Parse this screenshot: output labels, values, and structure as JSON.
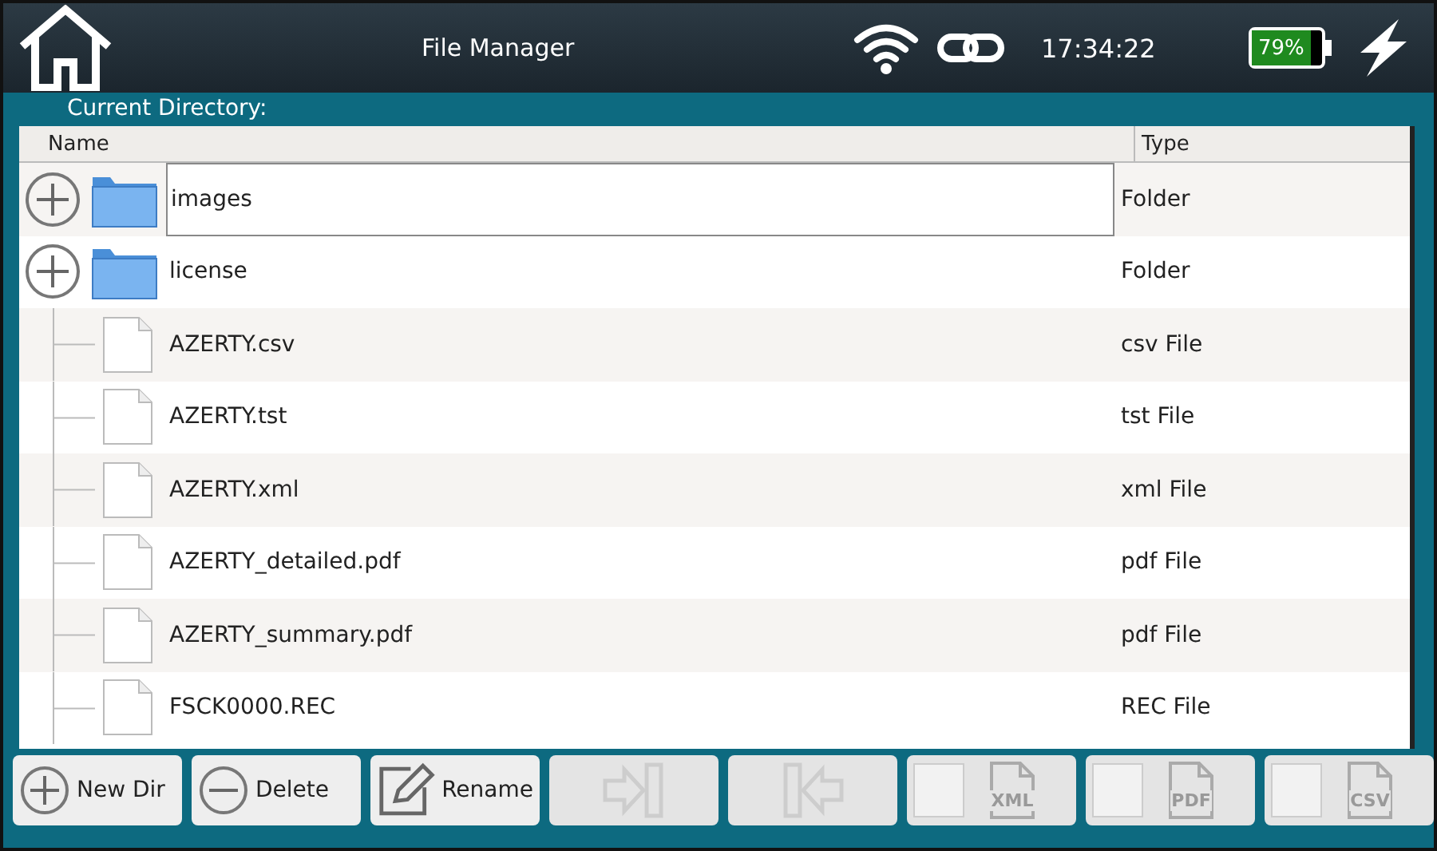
{
  "header": {
    "title": "File Manager",
    "time": "17:34:22",
    "battery": "79%"
  },
  "directory": {
    "label": "Current Directory:"
  },
  "table": {
    "columns": [
      "Name",
      "Type"
    ],
    "rows": [
      {
        "kind": "folder",
        "name": "images",
        "type": "Folder",
        "selected": true
      },
      {
        "kind": "folder",
        "name": "license",
        "type": "Folder",
        "selected": false
      },
      {
        "kind": "file",
        "name": "AZERTY.csv",
        "type": "csv File",
        "selected": false
      },
      {
        "kind": "file",
        "name": "AZERTY.tst",
        "type": "tst File",
        "selected": false
      },
      {
        "kind": "file",
        "name": "AZERTY.xml",
        "type": "xml File",
        "selected": false
      },
      {
        "kind": "file",
        "name": "AZERTY_detailed.pdf",
        "type": "pdf File",
        "selected": false
      },
      {
        "kind": "file",
        "name": "AZERTY_summary.pdf",
        "type": "pdf File",
        "selected": false
      },
      {
        "kind": "file",
        "name": "FSCK0000.REC",
        "type": "REC File",
        "selected": false
      }
    ]
  },
  "buttons": [
    {
      "kind": "plus",
      "label": "New Dir",
      "disabled": false
    },
    {
      "kind": "minus",
      "label": "Delete",
      "disabled": false
    },
    {
      "kind": "pencil",
      "label": "Rename",
      "disabled": false
    },
    {
      "kind": "import",
      "disabled": true
    },
    {
      "kind": "export",
      "disabled": true
    },
    {
      "kind": "format",
      "label": "XML",
      "disabled": true,
      "checked": false
    },
    {
      "kind": "format",
      "label": "PDF",
      "disabled": true,
      "checked": false
    },
    {
      "kind": "format",
      "label": "CSV",
      "disabled": true,
      "checked": false
    }
  ]
}
